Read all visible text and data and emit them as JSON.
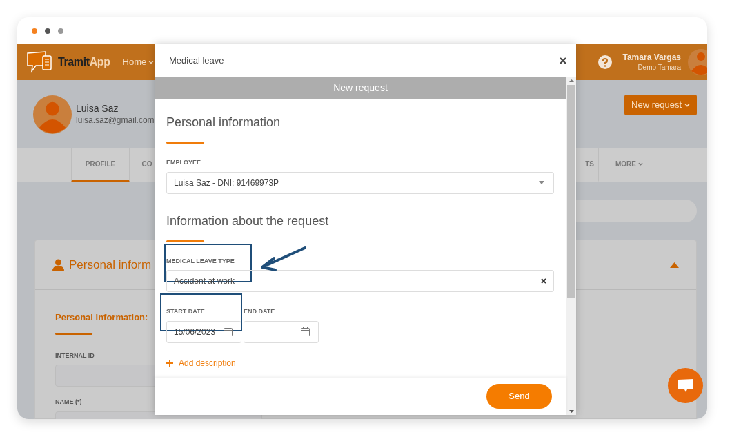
{
  "browser_frame": {
    "dots": [
      {
        "color": "#f58220"
      },
      {
        "color": "#555555"
      },
      {
        "color": "#999999"
      }
    ]
  },
  "header": {
    "logo": {
      "part_1": "Tramit",
      "part_2": "App"
    },
    "nav": [
      {
        "label": "Home"
      }
    ],
    "user": {
      "name": "Tamara Vargas",
      "subtitle": "Demo Tamara"
    }
  },
  "profile": {
    "name": "Luisa Saz",
    "email": "luisa.saz@gmail.com",
    "new_request_button": "New request"
  },
  "tabs": [
    {
      "label": "PROFILE",
      "selected": true,
      "dropdown": false
    },
    {
      "label": "CO",
      "selected": false,
      "dropdown": false
    },
    {
      "label": "TS",
      "selected": false,
      "dropdown": false
    },
    {
      "label": "MORE",
      "selected": false,
      "dropdown": true
    }
  ],
  "card": {
    "title": "Personal inform",
    "expanded": true,
    "section_title": "Personal information:",
    "fields": [
      {
        "label": "INTERNAL ID"
      },
      {
        "label": "NAME (*)"
      }
    ]
  },
  "modal": {
    "title": "Medical leave",
    "banner": "New request",
    "sections": [
      {
        "title": "Personal information",
        "fields": [
          {
            "kind": "select",
            "label": "EMPLOYEE",
            "value": "Luisa Saz - DNI: 91469973P"
          }
        ]
      },
      {
        "title": "Information about the request",
        "fields": [
          {
            "kind": "clearable",
            "label": "MEDICAL LEAVE TYPE",
            "value": "Accident at work"
          },
          {
            "kind": "dates",
            "label": "START DATE",
            "value": "15/06/2023",
            "label_2": "END DATE"
          }
        ]
      }
    ],
    "add_description": "Add description",
    "send_button": "Send"
  }
}
